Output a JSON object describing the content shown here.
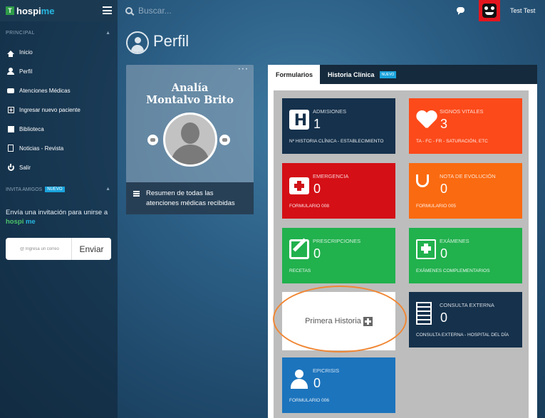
{
  "topbar": {
    "logo_prefix": "hospi",
    "logo_suffix": "me",
    "search_placeholder": "Buscar...",
    "username": "Test Test"
  },
  "sidebar": {
    "section_label": "PRINCIPAL",
    "items": [
      {
        "label": "Inicio",
        "icon": "home-icon"
      },
      {
        "label": "Perfil",
        "icon": "user-icon"
      },
      {
        "label": "Atenciones Médicas",
        "icon": "cars-icon"
      },
      {
        "label": "Ingresar nuevo paciente",
        "icon": "plus-square-icon"
      },
      {
        "label": "Biblioteca",
        "icon": "book-icon"
      },
      {
        "label": "Noticias - Revista",
        "icon": "document-icon"
      },
      {
        "label": "Salir",
        "icon": "power-icon"
      }
    ],
    "invite_section_label": "INVITA AMIGOS",
    "invite_badge": "NUEVO",
    "invite_text": "Envía una invitación para unirse a",
    "invite_brand_1": "hospi",
    "invite_brand_2": "me",
    "invite_placeholder": "@ Ingresa un correo",
    "invite_button": "Enviar"
  },
  "page": {
    "title": "Perfil"
  },
  "profile": {
    "name_line1": "Analía",
    "name_line2": "Montalvo Brito",
    "summary": "Resumen de todas las atenciones médicas recibidas"
  },
  "tabs": [
    {
      "label": "Formularios",
      "active": true
    },
    {
      "label": "Historia Clínica",
      "badge": "NUEVO",
      "active": false
    }
  ],
  "tiles": {
    "admisiones": {
      "label": "Admisiones",
      "count": "1",
      "sub": "Nº Historia Clínica - Establecimiento",
      "color": "#15314c"
    },
    "signos": {
      "label": "Signos Vitales",
      "count": "3",
      "sub": "TA - FC - FR - Saturación, etc",
      "color": "#fc4a1a"
    },
    "emergencia": {
      "label": "Emergencia",
      "count": "0",
      "sub": "Formulario 008",
      "color": "#d40f16"
    },
    "evolucion": {
      "label": "Nota de Evolución",
      "count": "0",
      "sub": "Formulario 005",
      "color": "#fa6a10"
    },
    "prescripciones": {
      "label": "Prescripciones",
      "count": "0",
      "sub": "Recetas",
      "color": "#21b14d"
    },
    "examenes": {
      "label": "Exámenes",
      "count": "0",
      "sub": "Exámenes Complementarios",
      "color": "#21b14d"
    },
    "consulta": {
      "label": "Consulta Externa",
      "count": "0",
      "sub": "Consulta Externa - Hospital del Día",
      "color": "#15314c"
    },
    "epicrisis": {
      "label": "Epicrisis",
      "count": "0",
      "sub": "Formulario 006",
      "color": "#1c74bd"
    }
  },
  "first_history": {
    "label": "Primera Historia"
  }
}
